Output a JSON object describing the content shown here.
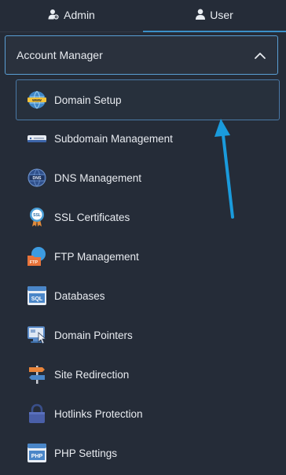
{
  "tabs": [
    {
      "label": "Admin",
      "icon": "admin-user-icon"
    },
    {
      "label": "User",
      "icon": "user-icon"
    }
  ],
  "account_manager": {
    "label": "Account Manager",
    "icon": "chevron-up-icon"
  },
  "menu": [
    {
      "label": "Domain Setup",
      "icon": "www-globe-icon"
    },
    {
      "label": "Subdomain Management",
      "icon": "server-rack-icon"
    },
    {
      "label": "DNS Management",
      "icon": "dns-globe-icon"
    },
    {
      "label": "SSL Certificates",
      "icon": "ssl-badge-icon"
    },
    {
      "label": "FTP Management",
      "icon": "ftp-folder-icon"
    },
    {
      "label": "Databases",
      "icon": "sql-database-icon"
    },
    {
      "label": "Domain Pointers",
      "icon": "monitor-pointer-icon"
    },
    {
      "label": "Site Redirection",
      "icon": "signpost-icon"
    },
    {
      "label": "Hotlinks Protection",
      "icon": "lock-icon"
    },
    {
      "label": "PHP Settings",
      "icon": "php-file-icon"
    }
  ],
  "colors": {
    "accent": "#3a90c8",
    "arrow": "#1a9bdc",
    "background": "#252c38"
  }
}
